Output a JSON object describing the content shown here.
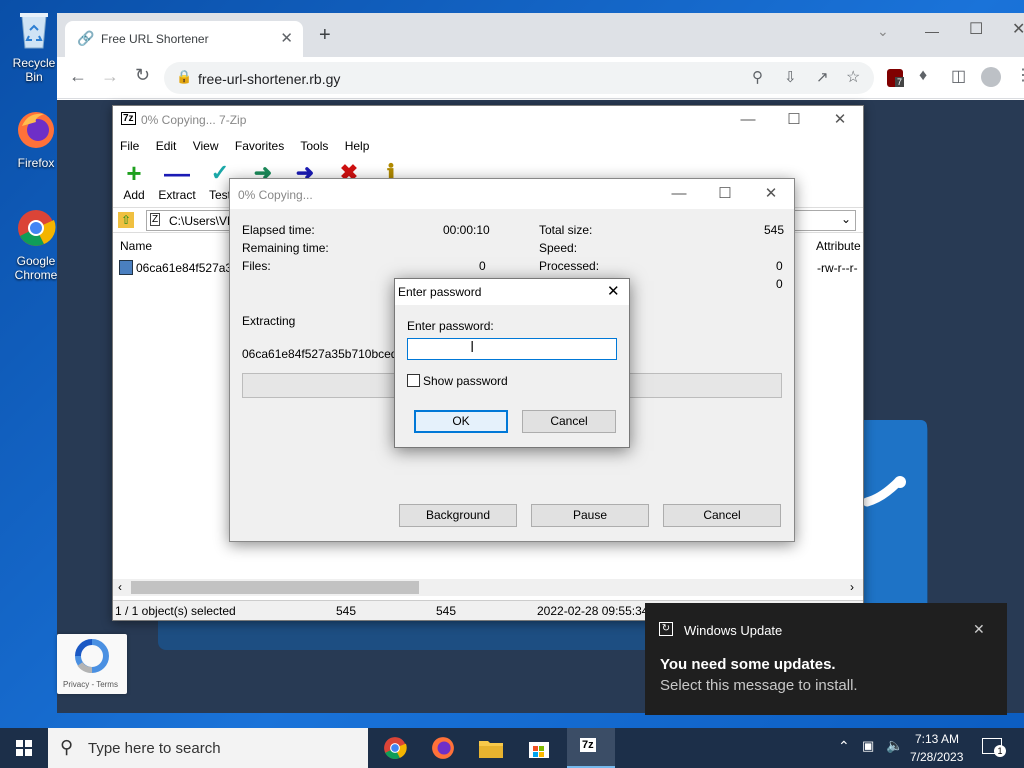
{
  "desktop": {
    "icons": [
      {
        "label": "Recycle Bin"
      },
      {
        "label": "Firefox"
      },
      {
        "label": "Google Chrome"
      }
    ]
  },
  "browser": {
    "tab_title": "Free URL Shortener",
    "url": "free-url-shortener.rb.gy",
    "extension_badge": "7"
  },
  "zip": {
    "title": "0% Copying... 7-Zip",
    "menu": [
      "File",
      "Edit",
      "View",
      "Favorites",
      "Tools",
      "Help"
    ],
    "toolbar": [
      "Add",
      "Extract",
      "Test"
    ],
    "path": "C:\\Users\\VM",
    "columns": {
      "name": "Name",
      "attributes": "Attribute"
    },
    "file": {
      "name": "06ca61e84f527a35",
      "attr": "-rw-r--r-"
    },
    "status": {
      "selected": "1 / 1 object(s) selected",
      "size1": "545",
      "size2": "545",
      "date": "2022-02-28 09:55:34"
    }
  },
  "progress": {
    "title": "0% Copying...",
    "elapsed_label": "Elapsed time:",
    "elapsed_value": "00:00:10",
    "remaining_label": "Remaining time:",
    "files_label": "Files:",
    "files_value": "0",
    "total_label": "Total size:",
    "total_value": "545",
    "speed_label": "Speed:",
    "processed_label": "Processed:",
    "processed_value": "0",
    "packed_value": "0",
    "extracting_label": "Extracting",
    "current_file": "06ca61e84f527a35b710bcedd1",
    "background_btn": "Background",
    "pause_btn": "Pause",
    "cancel_btn": "Cancel"
  },
  "password_dialog": {
    "title": "Enter password",
    "prompt": "Enter password:",
    "value": "",
    "show_password": "Show password",
    "ok": "OK",
    "cancel": "Cancel"
  },
  "recaptcha": {
    "text": "Privacy - Terms"
  },
  "notification": {
    "app": "Windows Update",
    "headline": "You need some updates.",
    "body": "Select this message to install."
  },
  "taskbar": {
    "search_placeholder": "Type here to search",
    "time": "7:13 AM",
    "date": "7/28/2023",
    "notif_count": "1"
  },
  "colors": {
    "accent": "#0078d7",
    "page_bg": "#283a54",
    "taskbar": "#1c2f49"
  }
}
